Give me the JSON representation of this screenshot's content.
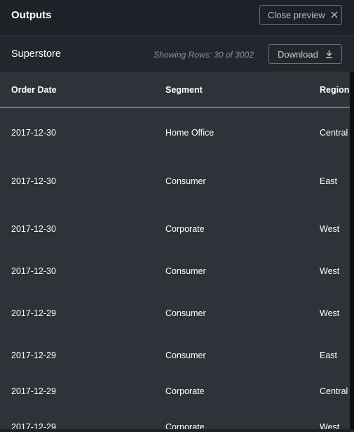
{
  "header": {
    "title": "Outputs",
    "close_label": "Close preview",
    "close_icon": "close-icon"
  },
  "dataset": {
    "name": "Superstore",
    "rows_text": "Showing Rows: 30 of 3002",
    "download_label": "Download",
    "download_icon": "download-icon"
  },
  "table": {
    "columns": [
      "Order Date",
      "Segment",
      "Region"
    ],
    "rows": [
      [
        "2017-12-30",
        "Home Office",
        "Central"
      ],
      [
        "2017-12-30",
        "Consumer",
        "East"
      ],
      [
        "2017-12-30",
        "Corporate",
        "West"
      ],
      [
        "2017-12-30",
        "Consumer",
        "West"
      ],
      [
        "2017-12-29",
        "Consumer",
        "West"
      ],
      [
        "2017-12-29",
        "Consumer",
        "East"
      ],
      [
        "2017-12-29",
        "Corporate",
        "Central"
      ],
      [
        "2017-12-29",
        "Corporate",
        "West"
      ]
    ]
  },
  "colors": {
    "header_bg": "#1e2127",
    "subheader_bg": "#23262c",
    "table_bg": "#2f3238",
    "text": "#ffffff",
    "muted": "#8d9098"
  }
}
